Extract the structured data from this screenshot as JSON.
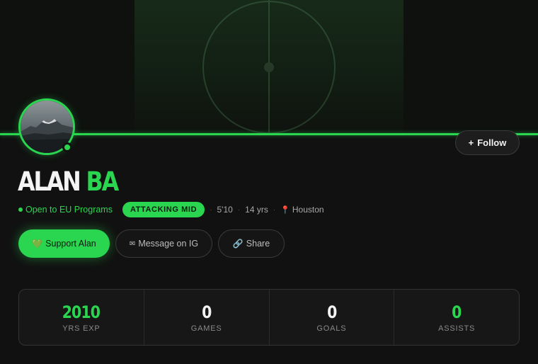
{
  "profile": {
    "first_name": "ALAN",
    "last_name": "BA",
    "status": "Open to EU Programs",
    "position": "ATTACKING MID",
    "height": "5'10",
    "age": "14 yrs",
    "location": "Houston",
    "status_color": "#2ad650",
    "accent_color": "#2ad650"
  },
  "actions": {
    "follow": "Follow",
    "follow_icon": "+",
    "support": "Support Alan",
    "support_icon": "green-heart-icon",
    "message": "Message on IG",
    "message_icon": "envelope-icon",
    "share": "Share",
    "share_icon": "link-icon"
  },
  "stats": [
    {
      "value": "2010",
      "label": "YRS EXP",
      "color": "green"
    },
    {
      "value": "0",
      "label": "GAMES",
      "color": "white"
    },
    {
      "value": "0",
      "label": "GOALS",
      "color": "white"
    },
    {
      "value": "0",
      "label": "ASSISTS",
      "color": "green"
    }
  ]
}
